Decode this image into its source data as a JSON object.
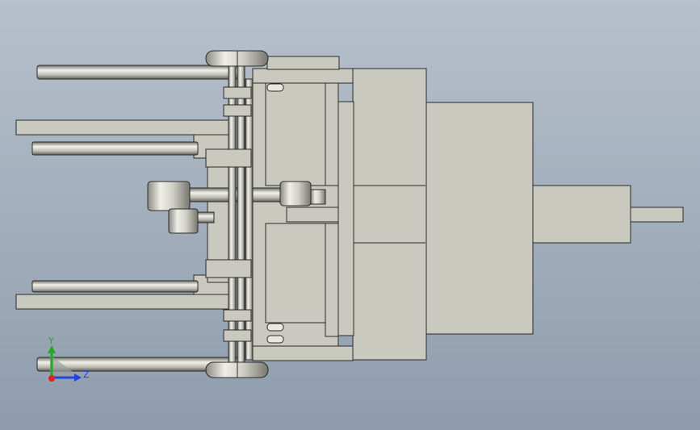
{
  "viewport": {
    "background_top": "#b7c1cc",
    "background_bottom": "#8e9cad"
  },
  "colors": {
    "part_fill": "#c9c9bf",
    "part_fill_light": "#d2d2c8",
    "edge": "#2b2b2b",
    "rod_light": "#f2f2ec",
    "rod_dark": "#6f6f68"
  },
  "triad": {
    "y_label": "Y",
    "z_label": "Z",
    "y_color": "#22aa22",
    "z_color": "#2244dd",
    "x_color": "#dd2222"
  }
}
